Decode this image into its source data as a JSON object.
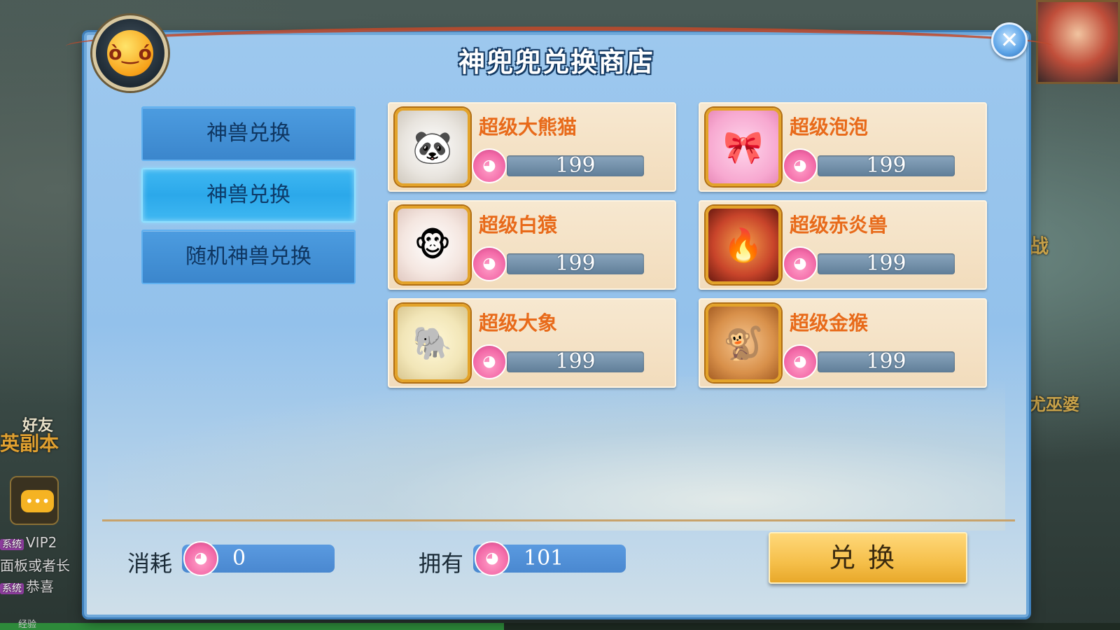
{
  "dialog": {
    "title": "神兜兜兑换商店",
    "close_glyph": "✕"
  },
  "tabs": [
    {
      "label": "神兽兑换",
      "active": false
    },
    {
      "label": "神兽兑换",
      "active": true
    },
    {
      "label": "随机神兽兑换",
      "active": false
    }
  ],
  "items": [
    {
      "name": "超级大熊猫",
      "price": "199",
      "icon": "panda-icon",
      "color": "#f3efe8"
    },
    {
      "name": "超级泡泡",
      "price": "199",
      "icon": "pink-blob-icon",
      "color": "#f7b5d6"
    },
    {
      "name": "超级白猿",
      "price": "199",
      "icon": "white-ape-icon",
      "color": "#f4ede6"
    },
    {
      "name": "超级赤炎兽",
      "price": "199",
      "icon": "fire-beast-icon",
      "color": "#c8442a"
    },
    {
      "name": "超级大象",
      "price": "199",
      "icon": "elephant-icon",
      "color": "#f2e6b8"
    },
    {
      "name": "超级金猴",
      "price": "199",
      "icon": "golden-monkey-icon",
      "color": "#d8904a"
    }
  ],
  "footer": {
    "cost_label": "消耗",
    "cost_value": "0",
    "own_label": "拥有",
    "own_value": "101",
    "exchange_label": "兑换"
  },
  "scene": {
    "chat_lines": [
      "面板或者长",
      "恭喜"
    ],
    "chat_tag": "系统",
    "side_text_left_1": "好友",
    "side_text_left_2": "英副本",
    "side_text_right_1": "战",
    "side_text_right_2": "尤巫婆",
    "vip_text": "VIP2",
    "xp_label": "经验"
  },
  "colors": {
    "dialog_bg": "#93c1eb",
    "tab_active": "#2ba8ea",
    "card_bg": "#f2dcbc",
    "item_name": "#e86a1a",
    "exchange_button": "#f5bf4a"
  }
}
